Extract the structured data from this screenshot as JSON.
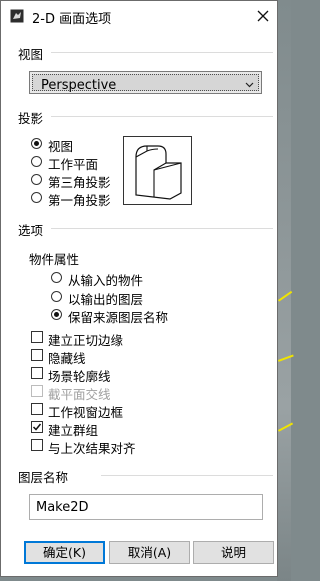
{
  "window": {
    "title": "2-D 画面选项",
    "close_icon": "close-icon"
  },
  "view": {
    "label": "视图",
    "dropdown": {
      "value": "Perspective"
    }
  },
  "projection": {
    "label": "投影",
    "options": [
      {
        "label": "视图",
        "selected": true
      },
      {
        "label": "工作平面",
        "selected": false
      },
      {
        "label": "第三角投影",
        "selected": false
      },
      {
        "label": "第一角投影",
        "selected": false
      }
    ]
  },
  "options": {
    "label": "选项",
    "object_properties": {
      "label": "物件属性",
      "choices": [
        {
          "label": "从输入的物件",
          "selected": false
        },
        {
          "label": "以输出的图层",
          "selected": false
        },
        {
          "label": "保留来源图层名称",
          "selected": true
        }
      ]
    },
    "checkboxes": [
      {
        "label": "建立正切边缘",
        "checked": false,
        "enabled": true
      },
      {
        "label": "隐藏线",
        "checked": false,
        "enabled": true
      },
      {
        "label": "场景轮廓线",
        "checked": false,
        "enabled": true
      },
      {
        "label": "截平面交线",
        "checked": false,
        "enabled": false
      },
      {
        "label": "工作视窗边框",
        "checked": false,
        "enabled": true
      },
      {
        "label": "建立群组",
        "checked": true,
        "enabled": true
      },
      {
        "label": "与上次结果对齐",
        "checked": false,
        "enabled": true
      }
    ]
  },
  "layer_name": {
    "label": "图层名称",
    "value": "Make2D"
  },
  "buttons": {
    "ok": "确定(K)",
    "cancel": "取消(A)",
    "help": "说明"
  },
  "colors": {
    "accent": "#0078d7",
    "background_lines": "#f0e400"
  }
}
